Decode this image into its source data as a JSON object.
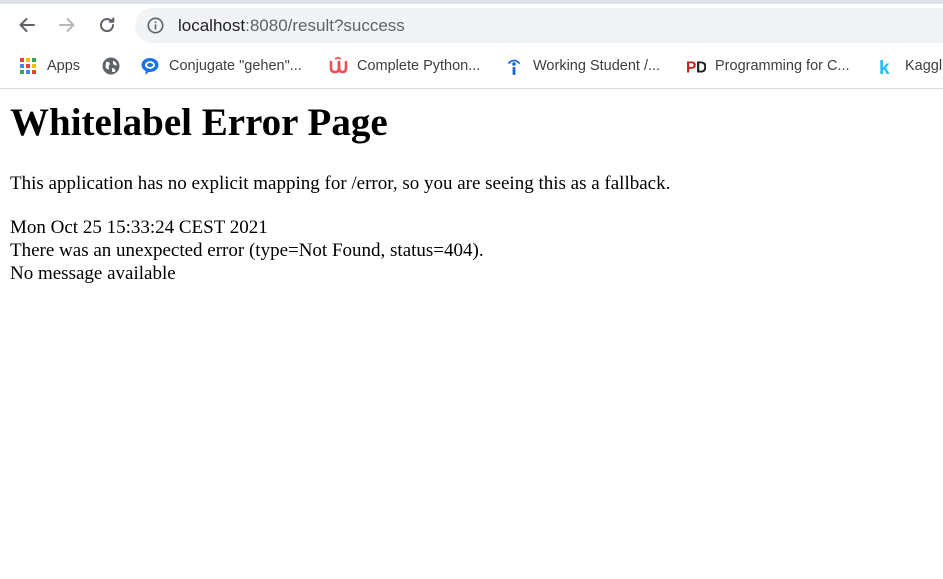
{
  "browser": {
    "url_host": "localhost",
    "url_rest": ":8080/result?success",
    "nav": {
      "back": "back-arrow-icon",
      "forward": "forward-arrow-icon",
      "reload": "reload-icon",
      "site_info": "info-icon"
    },
    "bookmarks": [
      {
        "label": "Apps",
        "icon": "apps-grid-icon"
      },
      {
        "label": "",
        "icon": "globe-icon"
      },
      {
        "label": "Conjugate \"gehen\"...",
        "icon": "speech-bubble-icon"
      },
      {
        "label": "Complete Python...",
        "icon": "udemy-icon"
      },
      {
        "label": "Working Student /...",
        "icon": "info-person-icon"
      },
      {
        "label": "Programming for C...",
        "icon": "pd-logo-icon"
      },
      {
        "label": "Kaggl",
        "icon": "kaggle-icon"
      }
    ],
    "colors": {
      "omnibox_bg": "#f1f3f4",
      "text_muted": "#5f6368",
      "conjugate_blue": "#1a73e8",
      "udemy_red": "#ec5252",
      "student_blue": "#1967d2",
      "pd_red": "#c5221f",
      "kaggle_blue": "#20beff"
    }
  },
  "page": {
    "title": "Whitelabel Error Page",
    "intro": "This application has no explicit mapping for /error, so you are seeing this as a fallback.",
    "timestamp": "Mon Oct 25 15:33:24 CEST 2021",
    "error_line": "There was an unexpected error (type=Not Found, status=404).",
    "message": "No message available"
  }
}
